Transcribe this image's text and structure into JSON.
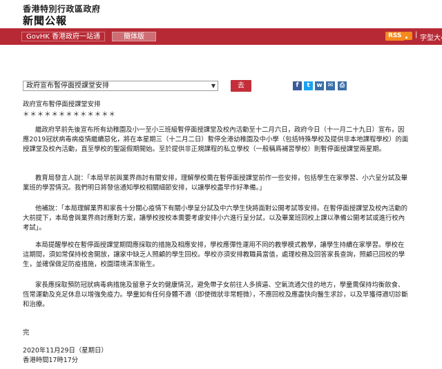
{
  "header": {
    "org_name": "香港特別行政區政府",
    "section_title": "新聞公報"
  },
  "navbar": {
    "gov_link": "GovHK 香港政府一站通",
    "simplified": "簡体版",
    "rss": "RSS",
    "separator": "|",
    "font_size": "字型大小"
  },
  "toolbar": {
    "select_value": "政府宣布暫停面授課堂安排",
    "go_label": "去"
  },
  "social": {
    "facebook": "f",
    "twitter": "t",
    "weibo": "w",
    "email": "✉",
    "print": "⎙"
  },
  "article": {
    "title": "政府宣布暫停面授課堂安排",
    "stars": "＊＊＊＊＊＊＊＊＊＊＊＊＊",
    "paragraphs": [
      "繼政府早前先後宣布所有幼稚園及小一至小三班級暫停面授課堂及校內活動至十二月六日，政府今日（十一月二十九日）宣布，因應2019冠狀病毒病疫情繼續惡化，將在本星期三（十二月二日）暫停全港幼稚園及中小學（包括特殊學校及提供非本地課程學校）的面授課堂及校內活動，直至學校的聖誕假期開始。至於提供非正規課程的私立學校（一般稱爲補習學校）則暫停面授課堂兩星期。",
      "教育局發言人說：「本局早前與業界商討有關安排，理解學校需在暫停面授課堂前作一些安排，包括學生在家學習、小六呈分試及畢業班的學習情況。我們明日將發信通知學校相關細節安排，以讓學校盡早作好準備。」",
      "他補說：「本局理解業界和家長十分關心疫情下有關小學呈分試及中六學生快將面對公開考試等安排。在暫停面授課堂及校內活動的大前提下，本局會與業界商討應對方案，讓學校按校本需要考慮安排小六進行呈分試，以及畢業班回校上課以準備公開考試或進行校內考試」。",
      "本局提醒學校在暫停面授課堂期間應採取的措施及相應安排，學校應彈性運用不同的教學模式教學，讓學生持續在家學習。學校在這期間，須如常保持校舍開放，讓家中缺乏人照顧的學生回校。學校亦須安排教職員當值，處理校務及回答家長查詢，照顧已回校的學生，並確保做足防疫措施，校園環境清潔衛生。",
      "家長應採取預防冠狀病毒病措施及留意子女的健康情況，避免帶子女前往人多擠逼、空氣流通欠佳的地方，學童需保持均衡飲食、恆常運動及充足休息以增強免疫力。學童如有任何身體不適（即使徵狀非常輕微），不應回校及應盡快向醫生求診，以及早獲得適切診斷和治療。"
    ],
    "end_mark": "完",
    "date": "2020年11月29日（星期日）",
    "time": "香港時間17時17分"
  }
}
